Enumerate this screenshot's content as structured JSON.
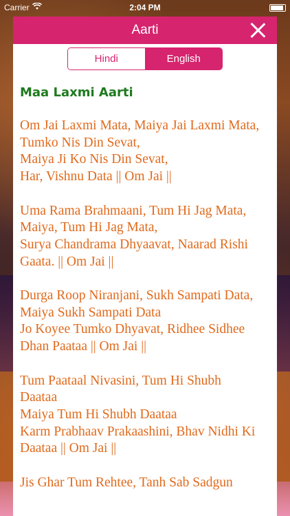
{
  "status_bar": {
    "carrier": "Carrier",
    "time": "2:04 PM"
  },
  "modal": {
    "title": "Aarti",
    "tabs": [
      {
        "label": "Hindi",
        "selected": false
      },
      {
        "label": "English",
        "selected": true
      }
    ],
    "aarti_title": "Maa Laxmi Aarti",
    "verses": [
      "Om Jai Laxmi Mata, Maiya Jai Laxmi Mata,\nTumko Nis Din Sevat,\nMaiya Ji Ko Nis Din Sevat,\nHar, Vishnu Data || Om Jai ||",
      "Uma Rama Brahmaani, Tum Hi Jag Mata,\nMaiya, Tum Hi Jag Mata,\nSurya Chandrama Dhyaavat, Naarad Rishi\nGaata. || Om Jai ||",
      "Durga Roop Niranjani, Sukh Sampati Data,\nMaiya Sukh Sampati Data\nJo Koyee Tumko Dhyavat, Ridhee Sidhee\nDhan Paataa || Om Jai ||",
      "Tum Paataal Nivasini, Tum Hi Shubh\nDaataa\nMaiya Tum Hi Shubh Daataa\nKarm Prabhaav Prakaashini, Bhav Nidhi Ki\nDaataa || Om Jai ||",
      "Jis Ghar Tum Rehtee, Tanh Sab Sadgun"
    ]
  },
  "colors": {
    "accent": "#d6246e",
    "title_green": "#1e7a1e",
    "verse_orange": "#e06a1c"
  },
  "icons": {
    "close": "close-icon",
    "wifi": "wifi-icon",
    "battery": "battery-icon"
  }
}
